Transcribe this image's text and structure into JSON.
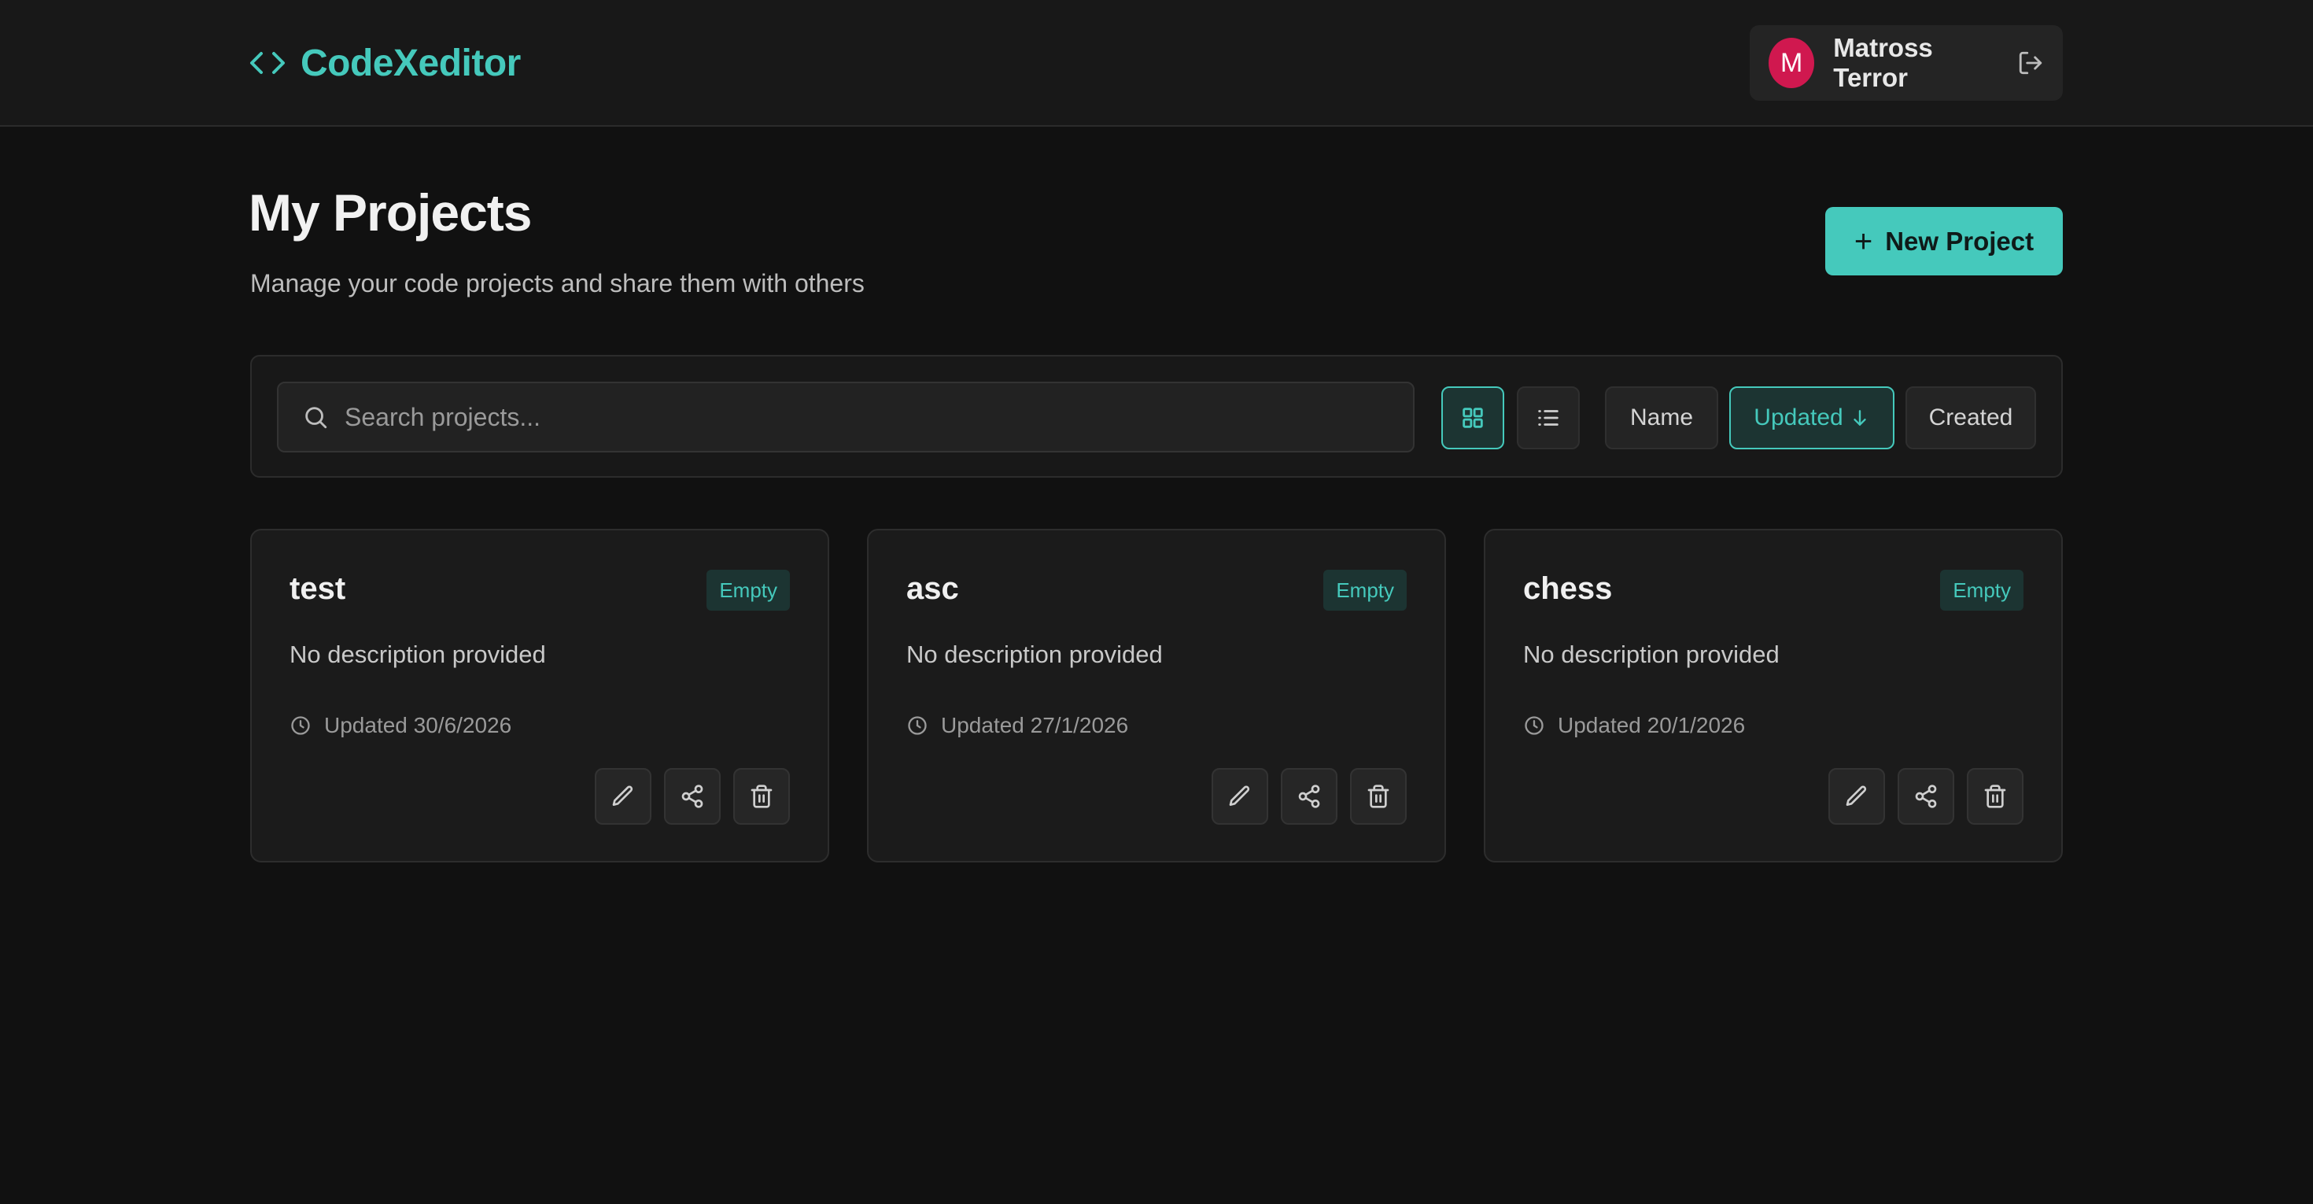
{
  "app": {
    "name": "CodeXeditor",
    "accent": "#45c9bc"
  },
  "user": {
    "name": "Matross Terror",
    "initial": "M",
    "avatar_color": "#d0184f"
  },
  "page": {
    "title": "My Projects",
    "subtitle": "Manage your code projects and share them with others",
    "new_project_label": "New Project"
  },
  "toolbar": {
    "search_placeholder": "Search projects...",
    "view_modes": [
      "grid",
      "list"
    ],
    "active_view": "grid",
    "sort": {
      "name_label": "Name",
      "updated_label": "Updated",
      "created_label": "Created",
      "active": "updated",
      "direction": "descending"
    }
  },
  "projects": [
    {
      "title": "test",
      "badge": "Empty",
      "description": "No description provided",
      "updated": "Updated 30/6/2026"
    },
    {
      "title": "asc",
      "badge": "Empty",
      "description": "No description provided",
      "updated": "Updated 27/1/2026"
    },
    {
      "title": "chess",
      "badge": "Empty",
      "description": "No description provided",
      "updated": "Updated 20/1/2026"
    }
  ]
}
